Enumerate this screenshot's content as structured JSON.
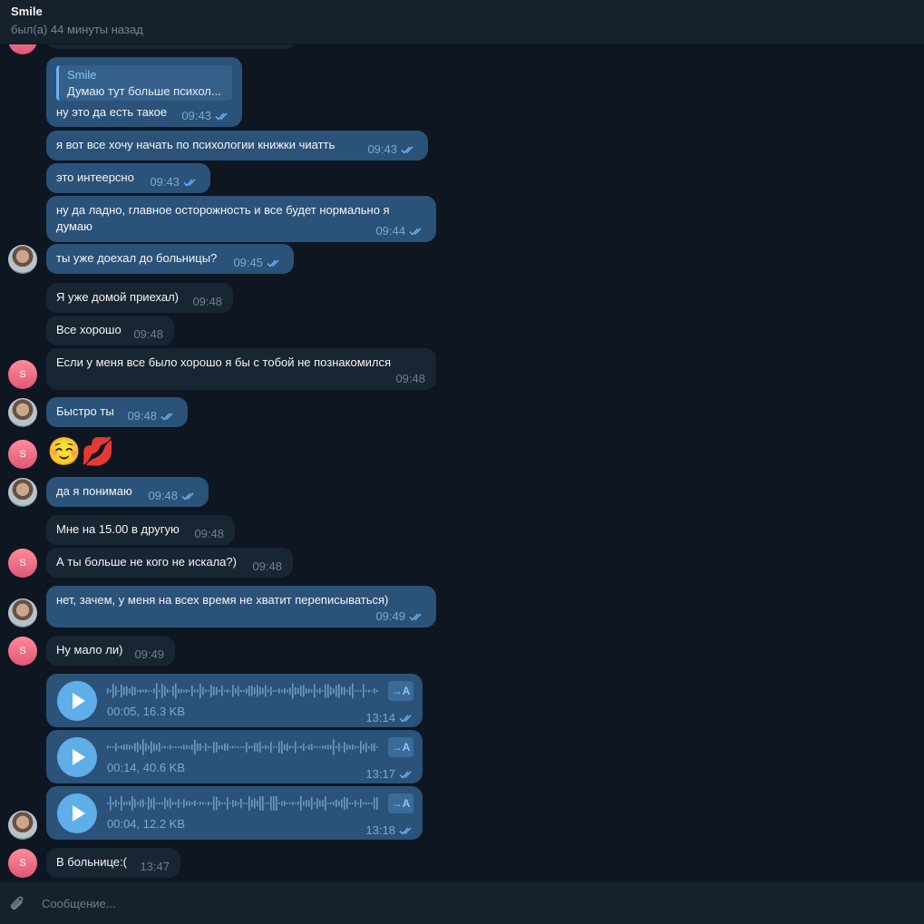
{
  "header": {
    "name": "Smile",
    "status": "был(а) 44 минуты назад"
  },
  "messages": [
    {
      "dir": "out",
      "text": "ну это да есть такое",
      "time": "09:43",
      "reply": {
        "name": "Smile",
        "text": "Думаю тут больше психол..."
      }
    },
    {
      "dir": "out",
      "text": "я вот все хочу начать по психологии книжки чиатть",
      "time": "09:43"
    },
    {
      "dir": "out",
      "text": "это интеерсно",
      "time": "09:43"
    },
    {
      "dir": "out",
      "text_line1": "ну да ладно, главное осторожность и все будет нормально я",
      "text_line2": "думаю",
      "time": "09:44"
    },
    {
      "dir": "out",
      "text": "ты уже доехал до больницы?",
      "time": "09:45"
    },
    {
      "dir": "in",
      "text": "Я уже домой приехал)",
      "time": "09:48"
    },
    {
      "dir": "in",
      "text": "Все хорошо",
      "time": "09:48"
    },
    {
      "dir": "in",
      "text": "Если у меня все было хорошо я бы с тобой не познакомился",
      "time": "09:48"
    },
    {
      "dir": "out",
      "text": "Быстро ты",
      "time": "09:48"
    },
    {
      "dir": "in",
      "emoji": "☺️💋"
    },
    {
      "dir": "out",
      "text": "да я понимаю",
      "time": "09:48"
    },
    {
      "dir": "in",
      "text": "Мне на 15.00 в другую",
      "time": "09:48"
    },
    {
      "dir": "in",
      "text": "А ты больше не кого не искала?)",
      "time": "09:48"
    },
    {
      "dir": "out",
      "text": "нет, зачем, у меня на всех время не хватит переписываться)",
      "time": "09:49"
    },
    {
      "dir": "in",
      "text": "Ну мало ли)",
      "time": "09:49"
    },
    {
      "dir": "out",
      "type": "voice",
      "duration": "00:05, 16.3 KB",
      "time": "13:14"
    },
    {
      "dir": "out",
      "type": "voice",
      "duration": "00:14, 40.6 KB",
      "time": "13:17"
    },
    {
      "dir": "out",
      "type": "voice",
      "duration": "00:04, 12.2 KB",
      "time": "13:18"
    },
    {
      "dir": "in",
      "text": "В больнице:(",
      "time": "13:47"
    }
  ],
  "avatars": {
    "contact_letter": "S",
    "contact_color": "#e05877"
  },
  "transcribe_label": "→A",
  "input": {
    "placeholder": "Сообщение..."
  },
  "colors": {
    "background": "#0e1621",
    "out_bubble": "#2b5278",
    "in_bubble": "#182533",
    "accent": "#5faee8"
  }
}
